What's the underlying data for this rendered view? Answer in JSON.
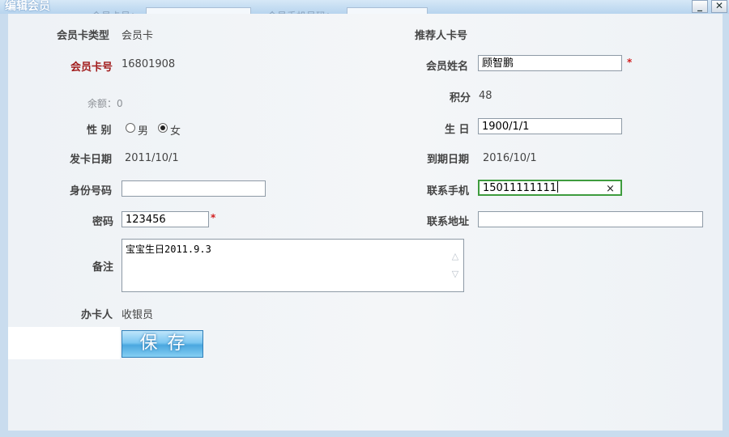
{
  "window": {
    "title": "编辑会员",
    "minimize_label": "_",
    "close_label": "✕",
    "behind_labels": [
      "会员卡号：",
      "会员手机号码："
    ]
  },
  "form": {
    "card_type": {
      "label": "会员卡类型",
      "value": "会员卡"
    },
    "referrer_card": {
      "label": "推荐人卡号"
    },
    "card_no": {
      "label": "会员卡号",
      "value": "16801908"
    },
    "member_name": {
      "label": "会员姓名",
      "value": "顾智鹏",
      "required": "*"
    },
    "balance": {
      "text": "余额：0"
    },
    "points": {
      "label": "积分",
      "value": "48"
    },
    "gender": {
      "label": "性 别",
      "options": [
        "男",
        "女"
      ],
      "selected": "女"
    },
    "birthday": {
      "label": "生 日",
      "value": "1900/1/1"
    },
    "issue_date": {
      "label": "发卡日期",
      "value": "2011/10/1"
    },
    "expire_date": {
      "label": "到期日期",
      "value": "2016/10/1"
    },
    "id_number": {
      "label": "身份号码",
      "value": ""
    },
    "mobile": {
      "label": "联系手机",
      "value": "15011111111",
      "clear_icon": "×"
    },
    "password": {
      "label": "密码",
      "value": "123456",
      "required": "*"
    },
    "address": {
      "label": "联系地址",
      "value": ""
    },
    "remark": {
      "label": "备注",
      "value": "宝宝生日2011.9.3"
    },
    "handler": {
      "label": "办卡人",
      "value": "收银员"
    }
  },
  "save_button": {
    "label": "保存"
  },
  "colors": {
    "accent_green": "#3e9c3e",
    "required_red": "#d21e1e",
    "label_red": "#a11b1b",
    "button_blue": "#4aa7df"
  }
}
